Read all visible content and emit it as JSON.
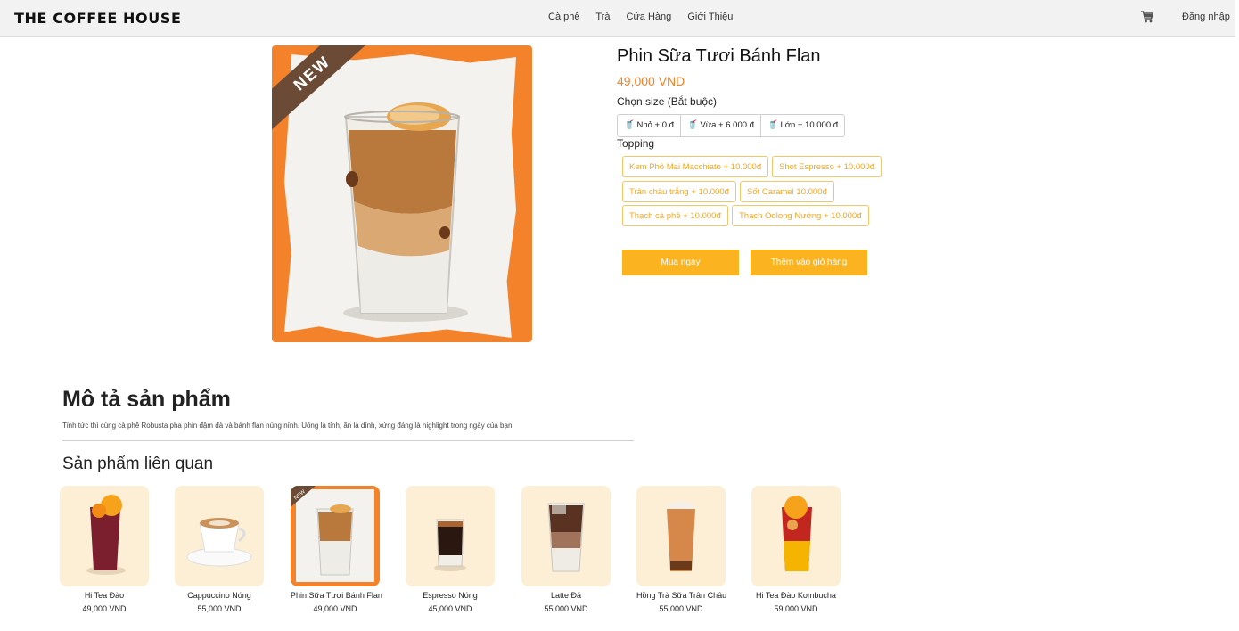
{
  "header": {
    "brand": "THE COFFEE HOUSE",
    "nav": [
      "Cà phê",
      "Trà",
      "Cửa Hàng",
      "Giới Thiệu"
    ],
    "login": "Đăng nhập",
    "cart_icon": "cart-icon"
  },
  "product": {
    "badge": "NEW",
    "name": "Phin Sữa Tươi Bánh Flan",
    "price": "49,000 VND",
    "size_label": "Chọn size (Bắt buộc)",
    "sizes": [
      "Nhỏ + 0 đ",
      "Vừa + 6.000 đ",
      "Lớn + 10.000 đ"
    ],
    "topping_label": "Topping",
    "toppings": [
      "Kem Phô Mai Macchiato + 10.000đ",
      "Shot Espresso + 10.000đ",
      "Trân châu trắng + 10.000đ",
      "Sốt Caramel 10.000đ",
      "Thạch cà phê + 10.000đ",
      "Thạch Oolong Nướng + 10.000đ"
    ],
    "buy_now": "Mua ngay",
    "add_to_cart": "Thêm vào giỏ hàng"
  },
  "description": {
    "title": "Mô tả sản phẩm",
    "text": "Tỉnh tức thì cùng cà phê Robusta pha phin đậm đà và bánh flan núng nính. Uống là tỉnh, ăn là dính, xứng đáng là highlight trong ngày của bạn."
  },
  "related": {
    "title": "Sản phẩm liên quan",
    "items": [
      {
        "name": "Hi Tea Đào",
        "price": "49,000 VND"
      },
      {
        "name": "Cappuccino Nóng",
        "price": "55,000 VND"
      },
      {
        "name": "Phin Sữa Tươi Bánh Flan",
        "price": "49,000 VND",
        "badge": "NEW"
      },
      {
        "name": "Espresso Nóng",
        "price": "45,000 VND"
      },
      {
        "name": "Latte Đá",
        "price": "55,000 VND"
      },
      {
        "name": "Hồng Trà Sữa Trân Châu",
        "price": "55,000 VND"
      },
      {
        "name": "Hi Tea Đào Kombucha",
        "price": "59,000 VND"
      }
    ]
  },
  "colors": {
    "accent": "#f4822a",
    "button": "#fbb41f",
    "topping_text": "#f5a623",
    "card_bg": "#fdefd6"
  }
}
